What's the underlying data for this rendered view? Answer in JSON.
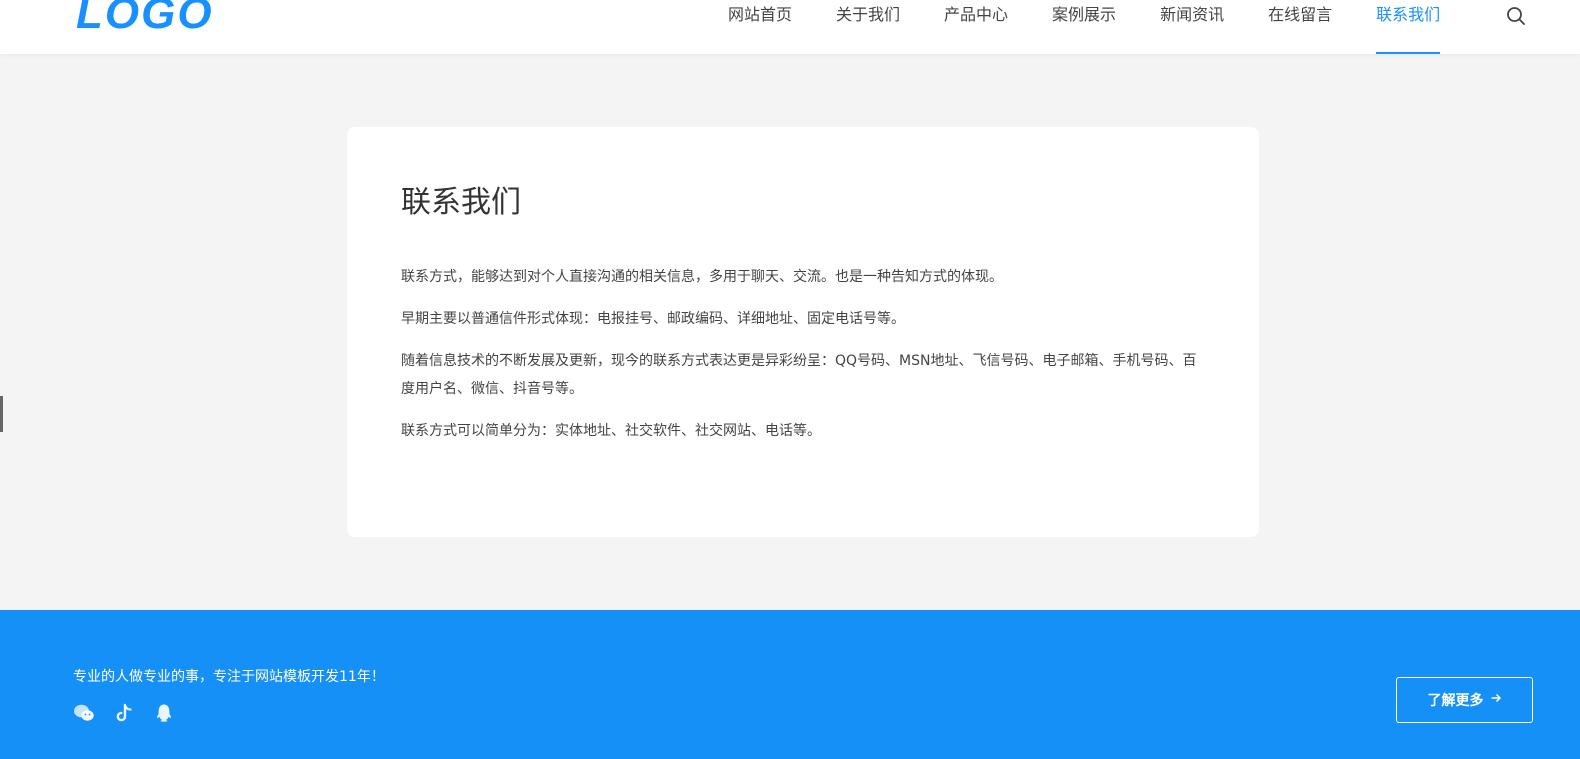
{
  "header": {
    "logo_text": "LOGO",
    "nav": [
      {
        "label": "网站首页"
      },
      {
        "label": "关于我们"
      },
      {
        "label": "产品中心"
      },
      {
        "label": "案例展示"
      },
      {
        "label": "新闻资讯"
      },
      {
        "label": "在线留言"
      },
      {
        "label": "联系我们",
        "active": true
      }
    ],
    "search_icon": "search-icon"
  },
  "main": {
    "title": "联系我们",
    "paragraphs": [
      "联系方式，能够达到对个人直接沟通的相关信息，多用于聊天、交流。也是一种告知方式的体现。",
      "早期主要以普通信件形式体现：电报挂号、邮政编码、详细地址、固定电话号等。",
      "随着信息技术的不断发展及更新，现今的联系方式表达更是异彩纷呈：QQ号码、MSN地址、飞信号码、电子邮箱、手机号码、百度用户名、微信、抖音号等。",
      "联系方式可以简单分为：实体地址、社交软件、社交网站、电话等。"
    ]
  },
  "footer": {
    "slogan": "专业的人做专业的事，专注于网站模板开发11年！",
    "social_icons": [
      "wechat-icon",
      "tiktok-icon",
      "qq-icon"
    ],
    "more_button_label": "了解更多",
    "more_button_icon": "arrow-right-icon"
  },
  "colors": {
    "accent": "#1890ff",
    "footer_bg": "#1590f7",
    "page_bg": "#f4f4f4"
  }
}
